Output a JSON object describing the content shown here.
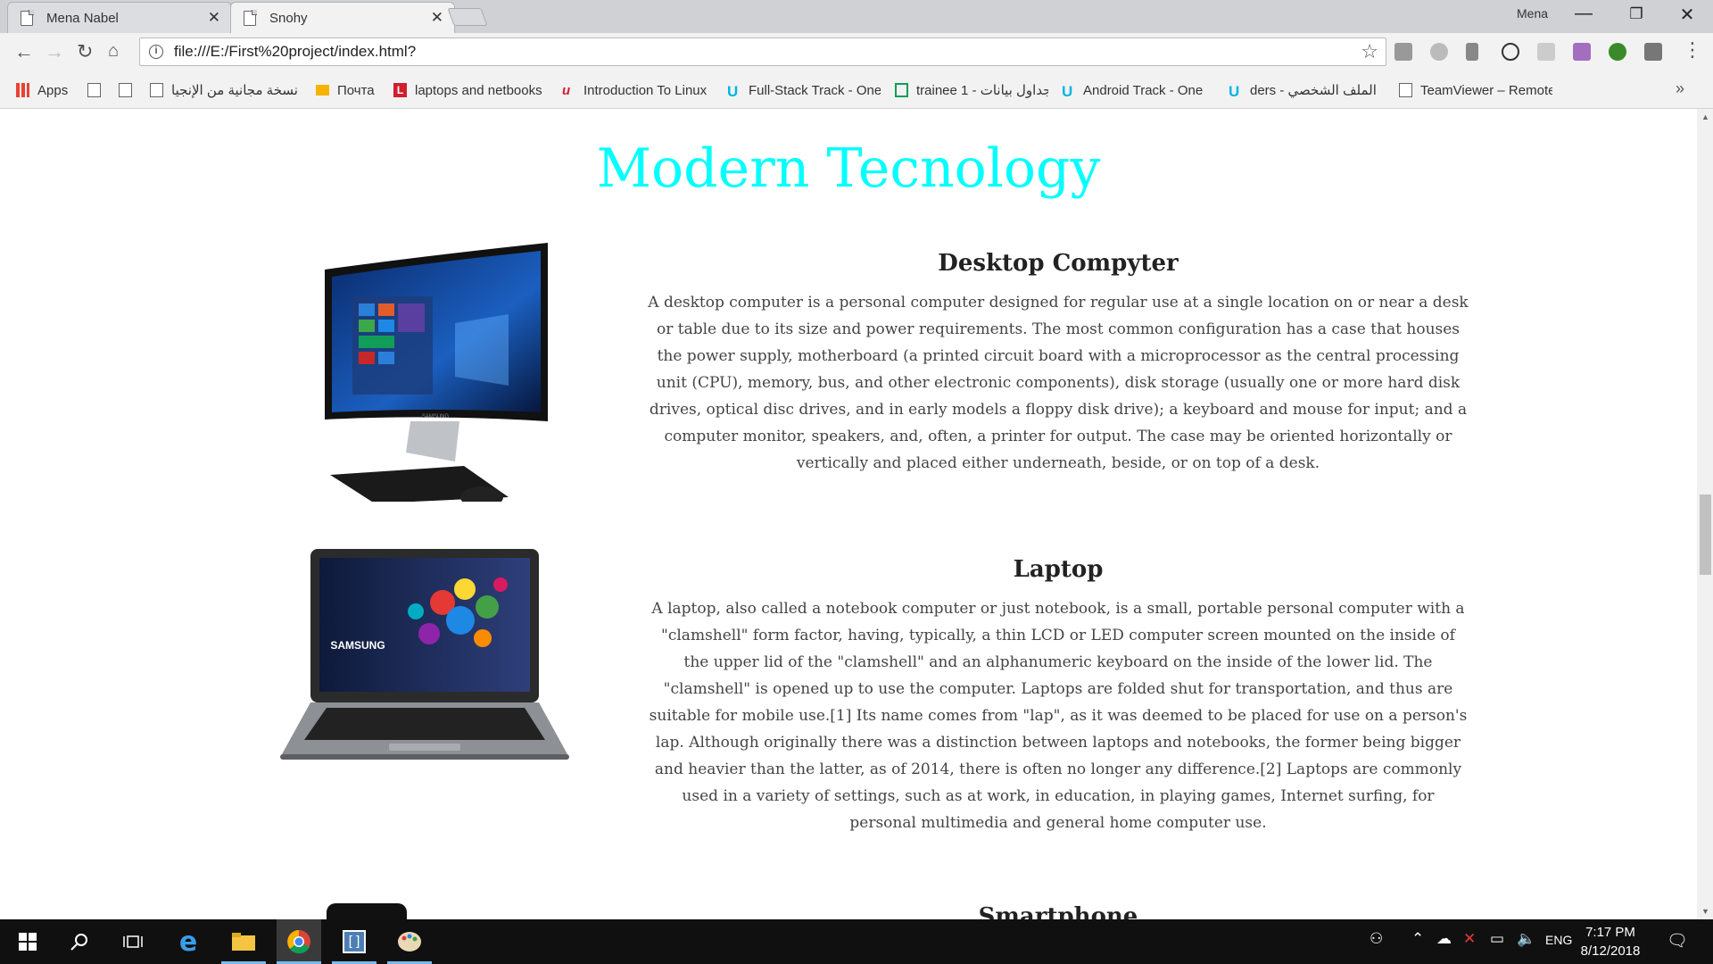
{
  "browser": {
    "tabs": [
      {
        "title": "Mena Nabel",
        "active": false
      },
      {
        "title": "Snohy",
        "active": true
      }
    ],
    "user_name": "Mena",
    "url": "file:///E:/First%20project/index.html?",
    "bookmarks": [
      {
        "label": "Apps",
        "icon": "apps-grid-icon"
      },
      {
        "label": "",
        "icon": "page-icon"
      },
      {
        "label": "",
        "icon": "page-icon"
      },
      {
        "label": "نسخة مجانية من الإنجيا",
        "icon": "page-icon"
      },
      {
        "label": "Почта",
        "icon": "mail-icon"
      },
      {
        "label": "laptops and netbooks",
        "icon": "l-logo-icon"
      },
      {
        "label": "Introduction To Linux",
        "icon": "u-logo-icon"
      },
      {
        "label": "Full-Stack Track - One",
        "icon": "udacity-icon"
      },
      {
        "label": "trainee 1 - جداول بيانات",
        "icon": "sheets-icon"
      },
      {
        "label": "Android Track - One",
        "icon": "udacity-icon"
      },
      {
        "label": "ders - الملف الشخصي",
        "icon": "udacity-icon"
      },
      {
        "label": "TeamViewer – Remote",
        "icon": "page-icon"
      }
    ],
    "more_bookmarks": "»"
  },
  "page": {
    "title": "Modern Tecnology",
    "sections": [
      {
        "heading": "Desktop Compyter",
        "text": "A desktop computer is a personal computer designed for regular use at a single location on or near a desk or table due to its size and power requirements. The most common configuration has a case that houses the power supply, motherboard (a printed circuit board with a microprocessor as the central processing unit (CPU), memory, bus, and other electronic components), disk storage (usually one or more hard disk drives, optical disc drives, and in early models a floppy disk drive); a keyboard and mouse for input; and a computer monitor, speakers, and, often, a printer for output. The case may be oriented horizontally or vertically and placed either underneath, beside, or on top of a desk.",
        "image": "desktop-computer-image",
        "monitor_brand": "SAMSUNG"
      },
      {
        "heading": "Laptop",
        "text": "A laptop, also called a notebook computer or just notebook, is a small, portable personal computer with a \"clamshell\" form factor, having, typically, a thin LCD or LED computer screen mounted on the inside of the upper lid of the \"clamshell\" and an alphanumeric keyboard on the inside of the lower lid. The \"clamshell\" is opened up to use the computer. Laptops are folded shut for transportation, and thus are suitable for mobile use.[1] Its name comes from \"lap\", as it was deemed to be placed for use on a person's lap. Although originally there was a distinction between laptops and notebooks, the former being bigger and heavier than the latter, as of 2014, there is often no longer any difference.[2] Laptops are commonly used in a variety of settings, such as at work, in education, in playing games, Internet surfing, for personal multimedia and general home computer use.",
        "image": "laptop-image",
        "screen_brand": "SAMSUNG"
      },
      {
        "heading": "Smartphone",
        "image": "smartphone-image"
      }
    ]
  },
  "taskbar": {
    "time": "7:17 PM",
    "date": "8/12/2018",
    "language": "ENG"
  },
  "colors": {
    "title_cyan": "#00ffff",
    "tab_strip": "#cfd1d4",
    "taskbar": "#101010"
  }
}
